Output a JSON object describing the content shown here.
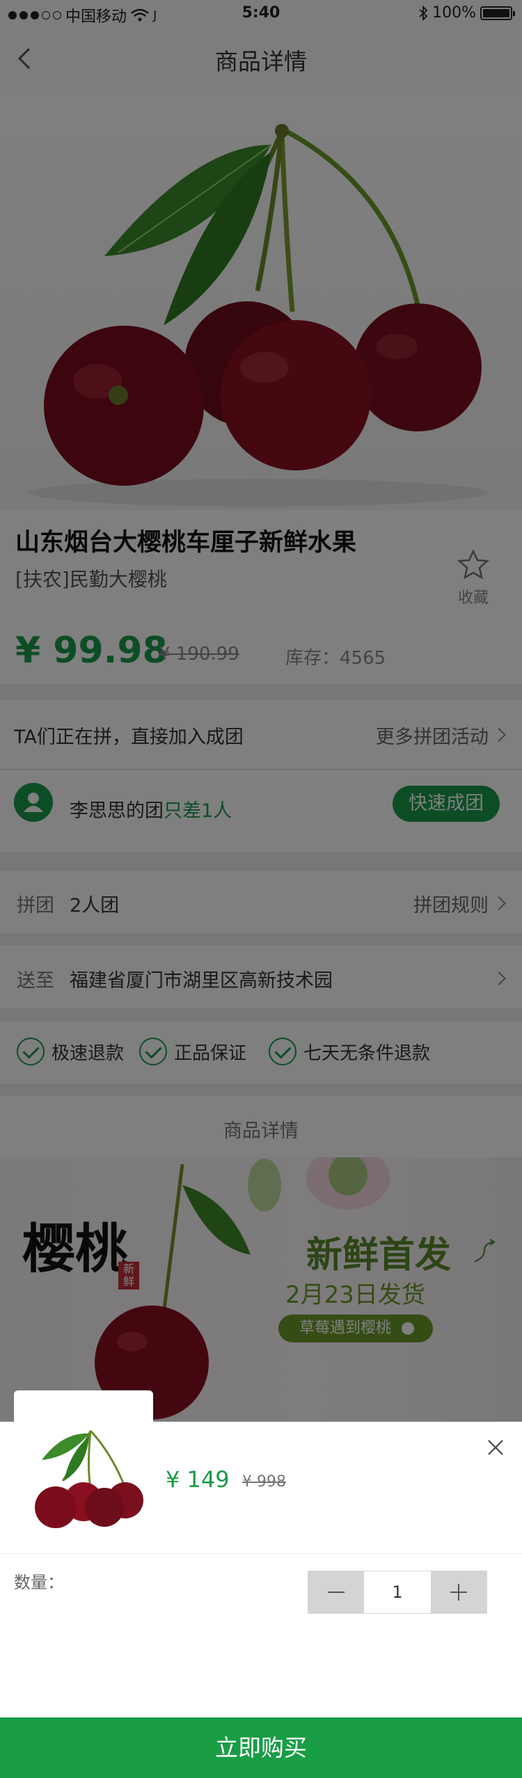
{
  "status_bar": {
    "carrier": "中国移动",
    "time": "5:40",
    "battery": "100%",
    "battery_level": 1.0
  },
  "nav": {
    "title": "商品详情"
  },
  "product": {
    "title": "山东烟台大樱桃车厘子新鲜水果",
    "subtitle": "[扶农]民勤大樱桃",
    "favorite_label": "收藏",
    "price": "¥ 99.98",
    "old_price": "¥ 190.99",
    "stock": "库存：4565"
  },
  "group_buy": {
    "header": "TA们正在拼，直接加入成团",
    "more_link": "更多拼团活动",
    "leader_text": "李思思的团",
    "need_text": "只差1人",
    "quick_button": "快速成团"
  },
  "group_type": {
    "label": "拼团",
    "value": "2人团",
    "rules_link": "拼团规则"
  },
  "delivery": {
    "label": "送至",
    "address": "福建省厦门市湖里区高新技术园"
  },
  "guarantees": [
    "极速退款",
    "正品保证",
    "七天无条件退款"
  ],
  "details_heading": "商品详情",
  "banner": {
    "calligraphy": "樱桃",
    "badge": "新鲜",
    "headline": "新鲜首发",
    "date_text": "2月23日发货",
    "pill_text": "草莓遇到樱桃"
  },
  "sheet": {
    "price": "¥ 149",
    "old_price": "¥ 998",
    "quantity_label": "数量：",
    "quantity": "1",
    "buy_button": "立即购买"
  },
  "colors": {
    "accent": "#1a9a4a",
    "buy_button": "#189d45"
  },
  "icons": [
    "back-icon",
    "star-icon",
    "user-icon",
    "chevron-right-icon",
    "check-circle-icon",
    "close-icon",
    "minus-icon",
    "plus-icon",
    "wifi-icon",
    "bluetooth-icon",
    "battery-icon"
  ]
}
